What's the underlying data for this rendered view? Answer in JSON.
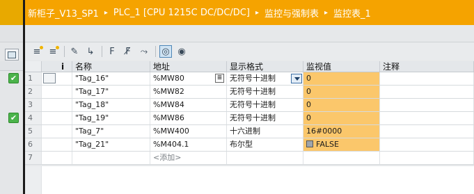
{
  "breadcrumb": [
    "新柜子_V13_SP1",
    "PLC_1 [CPU 1215C DC/DC/DC]",
    "监控与强制表",
    "监控表_1"
  ],
  "breadcrumb_separator": "▸",
  "toolbar": {
    "icons": [
      "insert-row-icon",
      "add-row-icon",
      "modify-value-icon",
      "modify-now-icon",
      "force-icon",
      "unforce-icon",
      "trigger-icon",
      "monitor-all-icon",
      "monitor-once-icon"
    ]
  },
  "table": {
    "headers": {
      "num": "",
      "i": "i",
      "name": "名称",
      "address": "地址",
      "format": "显示格式",
      "monitor": "监视值",
      "comment": "注释"
    },
    "rows": [
      {
        "num": "1",
        "name": "\"Tag_16\"",
        "address": "%MW80",
        "format": "无符号十进制",
        "monitor": "0"
      },
      {
        "num": "2",
        "name": "\"Tag_17\"",
        "address": "%MW82",
        "format": "无符号十进制",
        "monitor": "0"
      },
      {
        "num": "3",
        "name": "\"Tag_18\"",
        "address": "%MW84",
        "format": "无符号十进制",
        "monitor": "0"
      },
      {
        "num": "4",
        "name": "\"Tag_19\"",
        "address": "%MW86",
        "format": "无符号十进制",
        "monitor": "0"
      },
      {
        "num": "5",
        "name": "\"Tag_7\"",
        "address": "%MW400",
        "format": "十六进制",
        "monitor": "16#0000"
      },
      {
        "num": "6",
        "name": "\"Tag_21\"",
        "address": "%M404.1",
        "format": "布尔型",
        "monitor": "FALSE"
      },
      {
        "num": "7",
        "name": "",
        "address": "<添加>",
        "format": "",
        "monitor": ""
      }
    ]
  },
  "left_checks": [
    true,
    false,
    false,
    true,
    false,
    false,
    false
  ],
  "colors": {
    "accent": "#f5a300",
    "monitor_cell": "#fbc76b",
    "check": "#4bb34b"
  }
}
